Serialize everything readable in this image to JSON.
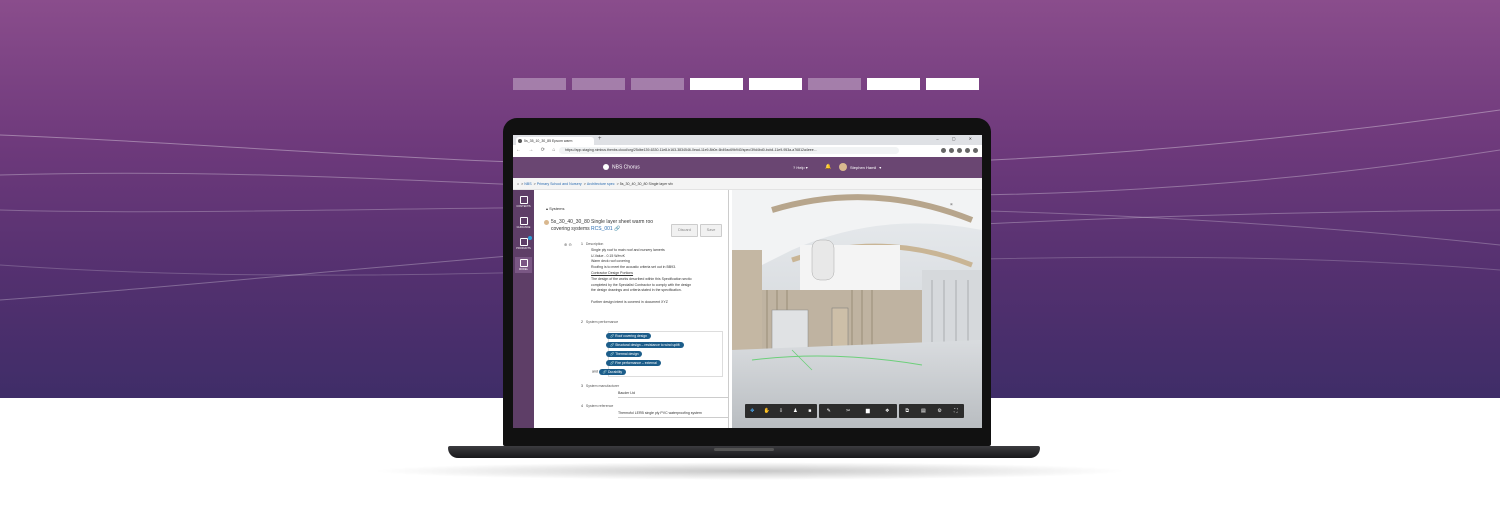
{
  "hero": {
    "tab_count": 8,
    "active_tabs": [
      3,
      4,
      6,
      7
    ]
  },
  "browser": {
    "tab_title": "5s_35_10_30_85 Epsom warm",
    "new_tab": "+",
    "window_controls": "– ▢ ✕",
    "url": "https://app-staging.nimbus.thenbs.cloud/org/25dbe139-6330-11e8-b163-3834546-0ead-11e9-8b0e-6b49ac69b940/spec/39d4bd0-bcb4-11e9-953a-a76812a4eee..."
  },
  "app": {
    "logo": "NBS Chorus",
    "help": "Help",
    "user_name": "Stephen Hamil"
  },
  "breadcrumb": {
    "home_icon": "home-icon",
    "items": [
      "NBS",
      "Primary School and Nursery",
      "Architecture spec",
      "5s_30_40_30_80 Single layer sfx"
    ],
    "separator": ">"
  },
  "sidebar": {
    "items": [
      {
        "label": "CONTENTS",
        "icon": "contents-icon"
      },
      {
        "label": "GUIDANCE",
        "icon": "guidance-icon"
      },
      {
        "label": "PRODUCTS",
        "icon": "products-icon"
      },
      {
        "label": "MODEL",
        "icon": "model-icon"
      }
    ]
  },
  "doc": {
    "section": "Systems",
    "title_line1": "5s_30_40_30_80  Single layer sheet warm roo",
    "title_line2": "covering systems",
    "title_code": "RCS_001",
    "discard": "Discard",
    "save": "Save",
    "clause1": {
      "num": "1",
      "label": "Description",
      "lines": [
        "Single ply roof to main roof and nursery larnerts",
        "U-Value - 0.15 W/m²K",
        "Warm deck roof covering",
        "Roofing is to meet the acoustic criteria set out in BB93.",
        "Contractor Design Portions",
        "The design of the works described within this Specification sectio",
        "completed by the Specialist Contractor to comply with the design",
        "the design drawings and criteria stated in the specification.",
        "",
        "Further design intent is covered in document XYZ"
      ]
    },
    "clause2": {
      "num": "2",
      "label": "System performance",
      "pills": [
        "Roof covering design",
        "Structural design – resistance to wind uplift",
        "Thermal design",
        "Fire performance – external",
        "Durability"
      ],
      "and": "and"
    },
    "clause3": {
      "num": "3",
      "label": "System manufacturer",
      "value": "Bauder Ltd"
    },
    "clause4": {
      "num": "4",
      "label": "System reference",
      "value": "Thermofol LERB single ply PVC waterproofing system"
    }
  },
  "viewer": {
    "toolbar_groups": [
      [
        "orbit-icon",
        "pan-icon",
        "first-person-icon",
        "walk-icon",
        "camera-icon"
      ],
      [
        "measure-icon",
        "section-icon",
        "folder-icon",
        "explode-icon"
      ],
      [
        "model-browser-icon",
        "properties-icon",
        "settings-icon",
        "fullscreen-icon"
      ]
    ],
    "toolbar_glyphs": [
      [
        "✥",
        "✋",
        "⇩",
        "♟",
        "■"
      ],
      [
        "✎",
        "✂",
        "▆",
        "❖"
      ],
      [
        "⧉",
        "▤",
        "⚙",
        "⛶"
      ]
    ]
  },
  "colors": {
    "hero_top": "#8a4d8c",
    "hero_bottom": "#3f2d68",
    "app_header": "#6a4672",
    "sidebar": "#5e3e67",
    "pill": "#1c5d8a",
    "link": "#2a6bb0"
  }
}
